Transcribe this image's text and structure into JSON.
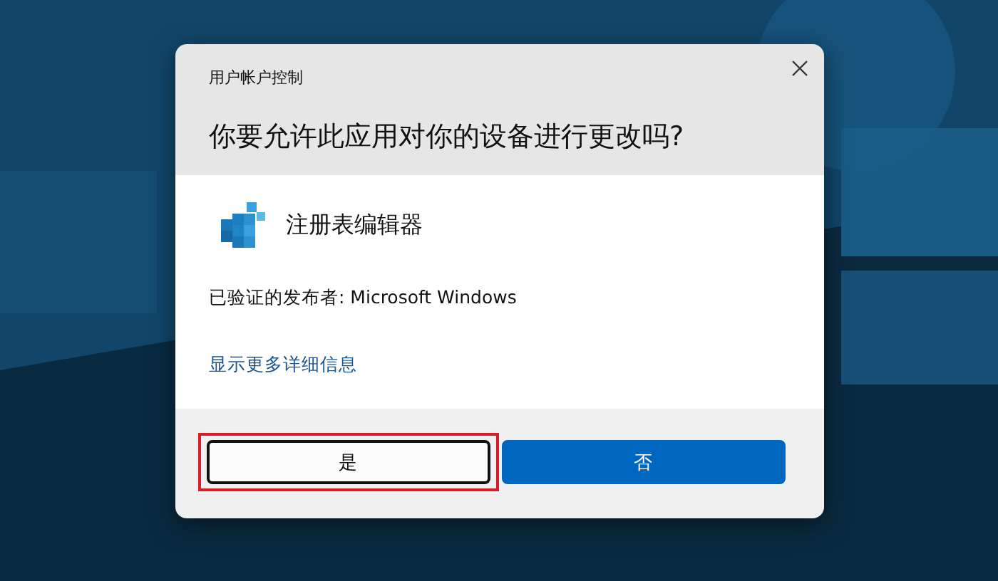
{
  "dialog": {
    "title": "用户帐户控制",
    "question": "你要允许此应用对你的设备进行更改吗?",
    "app": {
      "name": "注册表编辑器"
    },
    "publisher": "已验证的发布者: Microsoft Windows",
    "details_link": "显示更多详细信息",
    "buttons": [
      {
        "label": "是",
        "kind": "secondary",
        "focused": true,
        "highlighted": true
      },
      {
        "label": "否",
        "kind": "primary",
        "focused": false,
        "highlighted": false
      }
    ]
  }
}
